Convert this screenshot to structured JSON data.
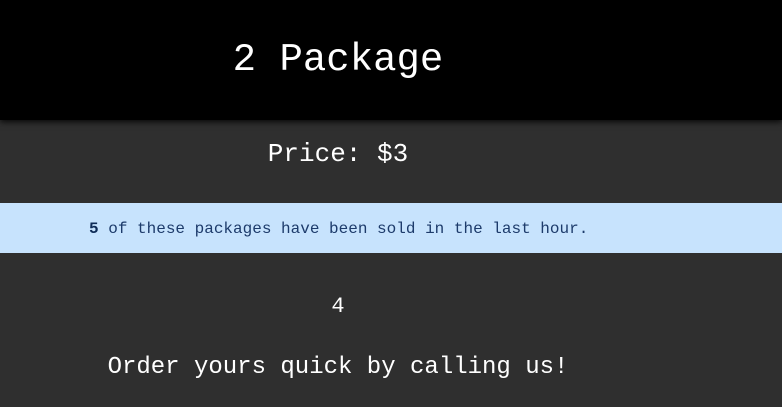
{
  "header": {
    "title": "2 Package"
  },
  "price": {
    "label": "Price: ",
    "value": "$3"
  },
  "banner": {
    "sold_count": "5",
    "sold_text": " of these packages have been sold in the last hour."
  },
  "quantity": {
    "value": "4"
  },
  "cta": {
    "text": "Order yours quick by calling us!"
  },
  "colors": {
    "background": "#2f2f2f",
    "header": "#000000",
    "banner": "#c7e3fd",
    "banner_text": "#1d3b6b"
  }
}
